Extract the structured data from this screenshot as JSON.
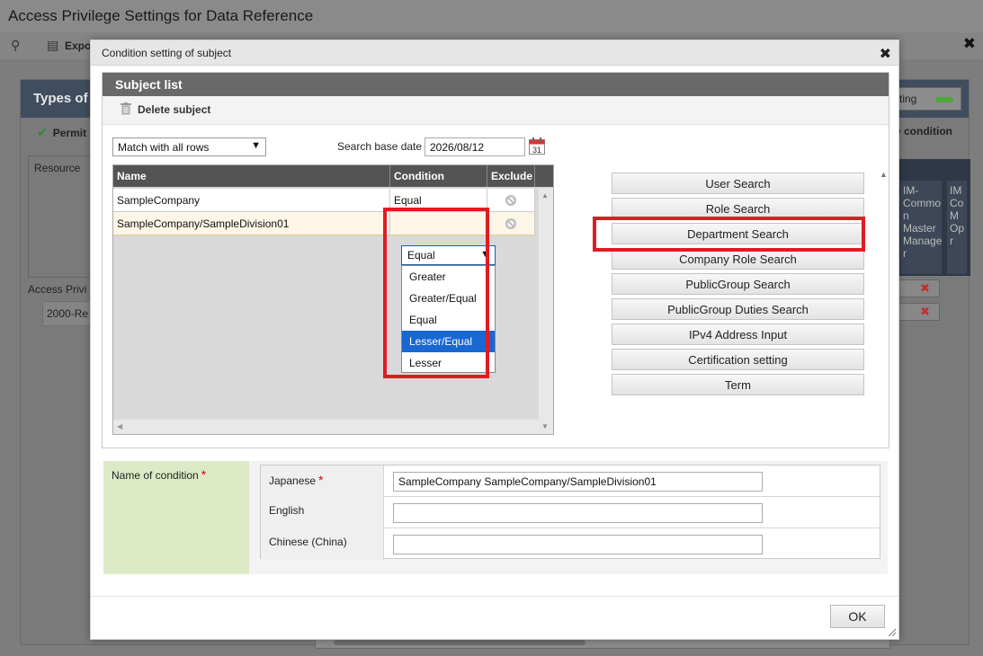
{
  "background": {
    "app_title": "Access Privilege Settings for Data Reference",
    "toolbar_export": "Expo",
    "panel_title": "Types of a",
    "setting_button": "setting",
    "permit_label": "Permit",
    "condition_label": "e condition",
    "resource_label": "Resource",
    "access_label": "Access Privi",
    "region_item": "2000-Re",
    "col1_lines": "IM-\nCommo\nn\nMaster\nManage\nr",
    "col2_lines": "IM\nCo\nM\nOp\nr"
  },
  "modal": {
    "title": "Condition setting of subject",
    "subject_list": {
      "header": "Subject list",
      "delete_label": "Delete subject",
      "match_select": "Match with all rows",
      "search_base_date_label": "Search base date",
      "search_base_date": "2026/08/12",
      "columns": {
        "name": "Name",
        "condition": "Condition",
        "exclude": "Exclude"
      },
      "rows": [
        {
          "name": "SampleCompany",
          "condition": "Equal"
        },
        {
          "name": "SampleCompany/SampleDivision01",
          "condition": "Equal"
        }
      ],
      "dropdown_options": [
        "Greater",
        "Greater/Equal",
        "Equal",
        "Lesser/Equal",
        "Lesser"
      ],
      "dropdown_highlighted": "Lesser/Equal"
    },
    "search_buttons": [
      "User Search",
      "Role Search",
      "Department Search",
      "Company Role Search",
      "PublicGroup Search",
      "PublicGroup Duties Search",
      "IPv4 Address Input",
      "Certification setting",
      "Term"
    ],
    "name_of_condition": {
      "label": "Name of condition",
      "required_mark": "*",
      "fields": [
        {
          "label": "Japanese",
          "required": "*",
          "value": "SampleCompany SampleCompany/SampleDivision01"
        },
        {
          "label": "English",
          "required": "",
          "value": ""
        },
        {
          "label": "Chinese (China)",
          "required": "",
          "value": ""
        }
      ]
    },
    "ok_label": "OK"
  },
  "colors": {
    "highlight_box": "#e11b22",
    "selected_option": "#1967d2",
    "panel_header": "#696969",
    "condition_label_bg": "#dcebc6"
  }
}
